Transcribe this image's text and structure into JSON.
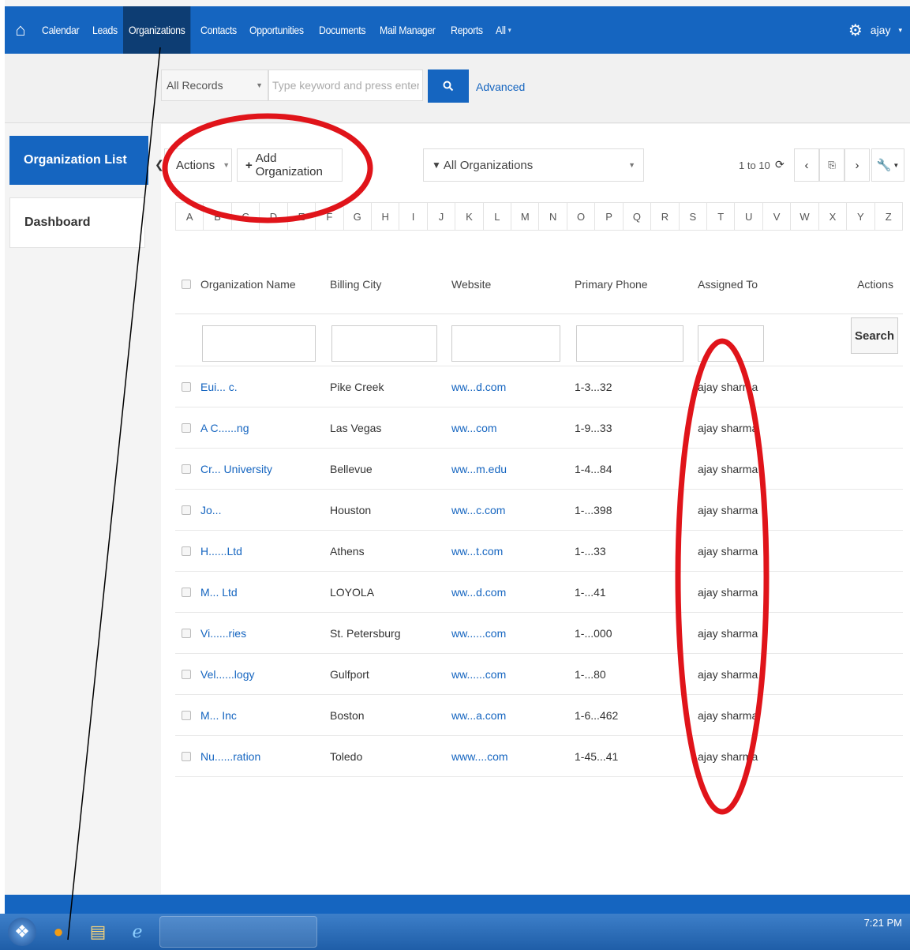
{
  "nav": {
    "items": [
      "Calendar",
      "Leads",
      "Organizations",
      "Contacts",
      "Opportunities",
      "Documents",
      "Mail Manager",
      "Reports",
      "All"
    ],
    "active": "Organizations",
    "user": "ajay"
  },
  "search": {
    "scope": "All Records",
    "placeholder": "Type keyword and press enter",
    "advanced": "Advanced"
  },
  "sidebar": {
    "items": [
      {
        "label": "Organization List",
        "active": true
      },
      {
        "label": "Dashboard",
        "active": false
      }
    ]
  },
  "toolbar": {
    "actions_label": "Actions",
    "add_label": "Add Organization",
    "filter_label": "All Organizations",
    "page_info": "1 to 10"
  },
  "alphabet": [
    "A",
    "B",
    "C",
    "D",
    "E",
    "F",
    "G",
    "H",
    "I",
    "J",
    "K",
    "L",
    "M",
    "N",
    "O",
    "P",
    "Q",
    "R",
    "S",
    "T",
    "U",
    "V",
    "W",
    "X",
    "Y",
    "Z"
  ],
  "table": {
    "columns": [
      "Organization Name",
      "Billing City",
      "Website",
      "Primary Phone",
      "Assigned To",
      "Actions"
    ],
    "search_button": "Search",
    "rows": [
      {
        "name": "Eui... c.",
        "city": "Pike Creek",
        "website": "ww...d.com",
        "phone": "1-3...32",
        "assigned": "ajay sharma"
      },
      {
        "name": "A C......ng",
        "city": "Las Vegas",
        "website": "ww...com",
        "phone": "1-9...33",
        "assigned": "ajay sharma"
      },
      {
        "name": "Cr... University",
        "city": "Bellevue",
        "website": "ww...m.edu",
        "phone": "1-4...84",
        "assigned": "ajay sharma"
      },
      {
        "name": "Jo...",
        "city": "Houston",
        "website": "ww...c.com",
        "phone": "1-...398",
        "assigned": "ajay sharma"
      },
      {
        "name": "H......Ltd",
        "city": "Athens",
        "website": "ww...t.com",
        "phone": "1-...33",
        "assigned": "ajay sharma"
      },
      {
        "name": "M... Ltd",
        "city": "LOYOLA",
        "website": "ww...d.com",
        "phone": "1-...41",
        "assigned": "ajay sharma"
      },
      {
        "name": "Vi......ries",
        "city": "St. Petersburg",
        "website": "ww......com",
        "phone": "1-...000",
        "assigned": "ajay sharma"
      },
      {
        "name": "Vel......logy",
        "city": "Gulfport",
        "website": "ww......com",
        "phone": "1-...80",
        "assigned": "ajay sharma"
      },
      {
        "name": "M... Inc",
        "city": "Boston",
        "website": "ww...a.com",
        "phone": "1-6...462",
        "assigned": "ajay sharma"
      },
      {
        "name": "Nu......ration",
        "city": "Toledo",
        "website": "www....com",
        "phone": "1-45...41",
        "assigned": "ajay sharma"
      }
    ]
  },
  "taskbar": {
    "clock": "7:21 PM"
  },
  "colors": {
    "primary": "#1565c0",
    "active_nav": "#0d3d73",
    "annotation": "#e0141a"
  }
}
